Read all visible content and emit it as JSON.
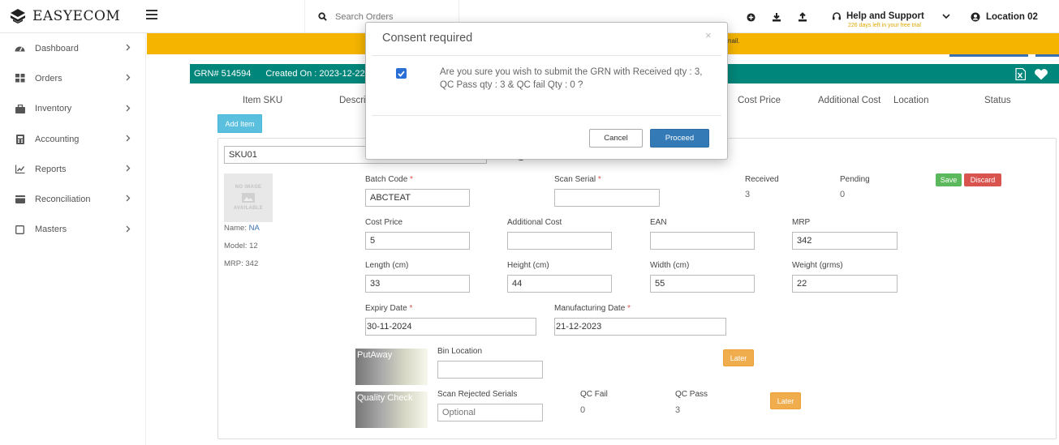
{
  "brand": {
    "name": "EASYECOM"
  },
  "search": {
    "placeholder": "Search Orders"
  },
  "help": {
    "title": "Help and Support",
    "subtitle": "226 days left in your free trial"
  },
  "location": {
    "label": "Location 02"
  },
  "sidebar": {
    "items": [
      {
        "label": "Dashboard",
        "icon": "dashboard-icon"
      },
      {
        "label": "Orders",
        "icon": "orders-icon"
      },
      {
        "label": "Inventory",
        "icon": "inventory-icon"
      },
      {
        "label": "Accounting",
        "icon": "accounting-icon"
      },
      {
        "label": "Reports",
        "icon": "reports-icon"
      },
      {
        "label": "Reconciliation",
        "icon": "reconciliation-icon"
      },
      {
        "label": "Masters",
        "icon": "masters-icon"
      }
    ]
  },
  "banner": {
    "text_fragment": "nail."
  },
  "grn": {
    "number": "GRN# 514594",
    "created": "Created On : 2023-12-22 1"
  },
  "table_headers": [
    "Item SKU",
    "Descri",
    "Cost Price",
    "Additional Cost",
    "Location",
    "Status"
  ],
  "add_item_label": "Add Item",
  "item": {
    "sku": "SKU01",
    "no_image_line1": "NO IMAGE",
    "no_image_line2": "AVAILABLE",
    "name_label": "Name:",
    "name_value": "NA",
    "model": "Model: 12",
    "mrp_text": "MRP: 342",
    "fields": {
      "batch_code": {
        "label": "Batch Code",
        "value": "ABCTEAT"
      },
      "scan_serial": {
        "label": "Scan Serial",
        "value": ""
      },
      "received": {
        "label": "Received",
        "value": "3"
      },
      "pending": {
        "label": "Pending",
        "value": "0"
      },
      "cost_price": {
        "label": "Cost Price",
        "value": "5"
      },
      "additional_cost": {
        "label": "Additional Cost",
        "value": ""
      },
      "ean": {
        "label": "EAN",
        "value": ""
      },
      "mrp": {
        "label": "MRP",
        "value": "342"
      },
      "length": {
        "label": "Length (cm)",
        "value": "33"
      },
      "height": {
        "label": "Height (cm)",
        "value": "44"
      },
      "width": {
        "label": "Width (cm)",
        "value": "55"
      },
      "weight": {
        "label": "Weight (grms)",
        "value": "22"
      },
      "expiry_date": {
        "label": "Expiry Date",
        "value": "30-11-2024"
      },
      "manufacturing_date": {
        "label": "Manufacturing Date",
        "value": "21-12-2023"
      },
      "bin_location": {
        "label": "Bin Location",
        "value": ""
      },
      "scan_rejected": {
        "label": "Scan Rejected Serials",
        "placeholder": "Optional"
      },
      "qc_fail": {
        "label": "QC Fail",
        "value": "0"
      },
      "qc_pass": {
        "label": "QC Pass",
        "value": "3"
      }
    },
    "save_label": "Save",
    "discard_label": "Discard",
    "putaway_label": "PutAway",
    "quality_check_label": "Quality Check",
    "later_label": "Later",
    "required_mark": "*"
  },
  "modal": {
    "title": "Consent required",
    "close": "×",
    "message": "Are you sure you wish to submit the GRN with Received qty : 3, QC Pass qty : 3 & QC fail Qty : 0 ?",
    "cancel": "Cancel",
    "proceed": "Proceed"
  },
  "colors": {
    "banner": "#f4b400",
    "grn_bar": "#00867a",
    "primary": "#337ab7",
    "success": "#5cb85c",
    "danger": "#d9534f",
    "warning": "#f0ad4e",
    "info": "#5bc0de"
  }
}
